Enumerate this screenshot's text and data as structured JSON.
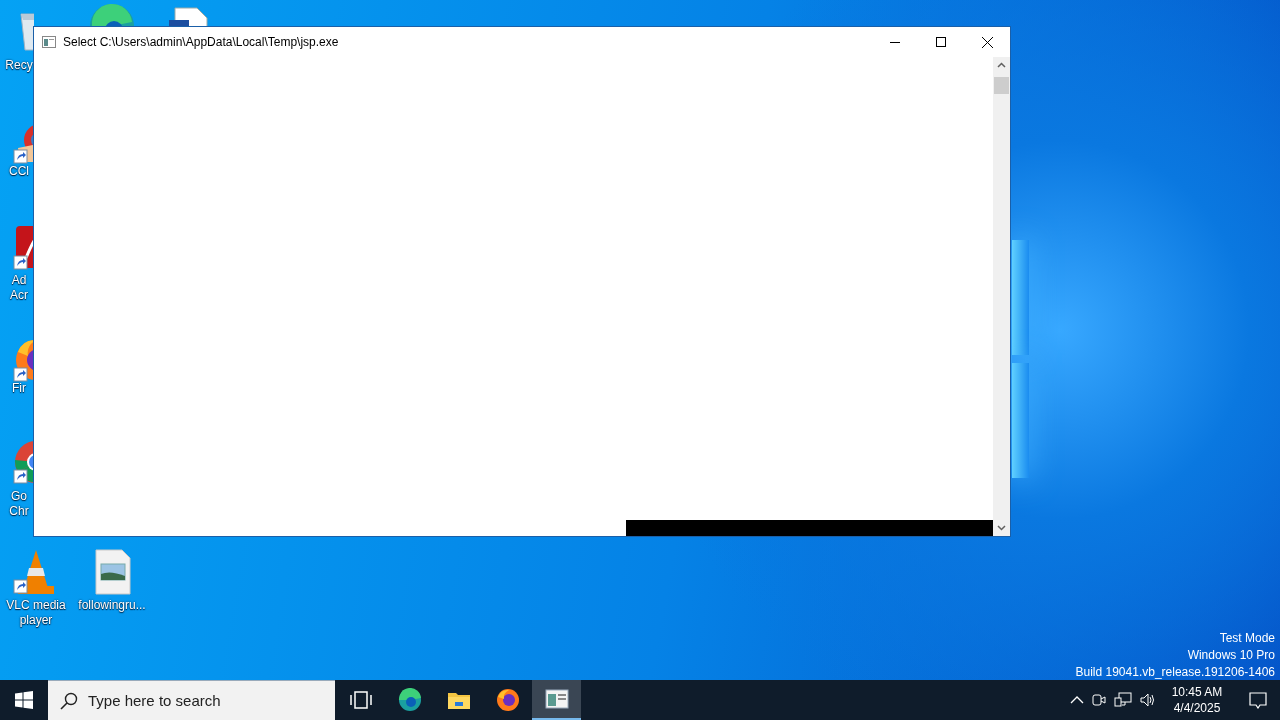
{
  "desktop_icons": [
    {
      "kind": "recycle-bin",
      "label": "Recy"
    },
    {
      "kind": "browser-edge"
    },
    {
      "kind": "document"
    },
    {
      "kind": "cleaner",
      "label": "CCl"
    },
    {
      "kind": "acrobat",
      "label": "Ad Acr"
    },
    {
      "kind": "firefox",
      "label": "Fir"
    },
    {
      "kind": "chrome",
      "label": "Go Chr"
    },
    {
      "kind": "vlc",
      "label": "VLC media player"
    },
    {
      "kind": "image-file",
      "label": "followingru..."
    }
  ],
  "window": {
    "title": "Select C:\\Users\\admin\\AppData\\Local\\Temp\\jsp.exe"
  },
  "system_info": [
    "Test Mode",
    "Windows 10 Pro",
    "Build 19041.vb_release.191206-1406"
  ],
  "taskbar": {
    "search": {
      "placeholder": "Type here to search"
    },
    "apps": [
      {
        "kind": "task-view",
        "active": false
      },
      {
        "kind": "edge",
        "active": false
      },
      {
        "kind": "explorer",
        "active": false
      },
      {
        "kind": "firefox",
        "active": false
      },
      {
        "kind": "console",
        "active": true
      }
    ],
    "clock": {
      "time": "10:45 AM",
      "date": "4/4/2025"
    }
  }
}
